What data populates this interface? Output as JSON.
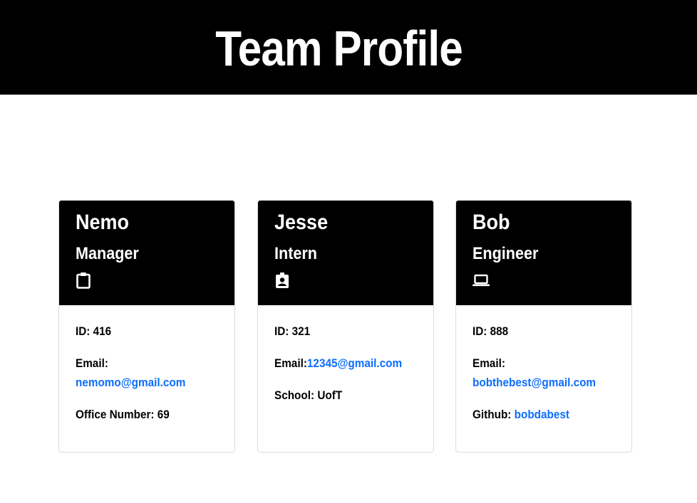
{
  "header": {
    "title": "Team Profile"
  },
  "cards": [
    {
      "name": "Nemo",
      "role": "Manager",
      "icon": "clipboard-icon",
      "id_label": "ID:",
      "id_value": "416",
      "email_label": "Email:",
      "email": "nemomo@gmail.com",
      "extra_label": "Office Number:",
      "extra_value": "69"
    },
    {
      "name": "Jesse",
      "role": "Intern",
      "icon": "student-badge-icon",
      "id_label": "ID:",
      "id_value": "321",
      "email_label": "Email:",
      "email": "12345@gmail.com",
      "extra_label": "School:",
      "extra_value": "UofT"
    },
    {
      "name": "Bob",
      "role": "Engineer",
      "icon": "laptop-icon",
      "id_label": "ID:",
      "id_value": "888",
      "email_label": "Email:",
      "email": "bobthebest@gmail.com",
      "extra_label": "Github:",
      "extra_value": "bobdabest"
    }
  ],
  "colors": {
    "header_bg": "#000000",
    "link": "#0d6efd",
    "text": "#000000",
    "card_border": "#dcdcdc"
  }
}
